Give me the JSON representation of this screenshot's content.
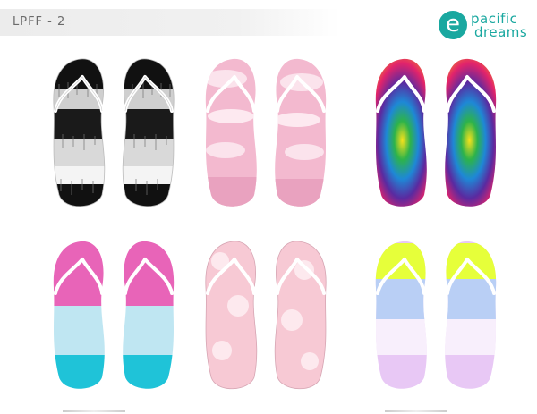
{
  "page": {
    "title": "LPFF - 2"
  },
  "brand": {
    "logo_text_line1": "pacific",
    "logo_text_line2": "dreams",
    "logo_mark": "e",
    "color": "#1aa8a0"
  },
  "designs": [
    {
      "id": "design-1",
      "name": "black-white-tie-dye",
      "colors": [
        "#111111",
        "#d8d8d8",
        "#ffffff"
      ]
    },
    {
      "id": "design-2",
      "name": "pink-tie-dye",
      "colors": [
        "#f3b9cf",
        "#fbe3ec",
        "#e796b6"
      ]
    },
    {
      "id": "design-3",
      "name": "rainbow-spiral-tie-dye",
      "colors": [
        "#5a2aa0",
        "#e2236b",
        "#f7e21b",
        "#2db34a",
        "#1e88d6"
      ]
    },
    {
      "id": "design-4",
      "name": "pink-blue-ombre",
      "colors": [
        "#e864b8",
        "#bfe6f2",
        "#1fc3d8"
      ]
    },
    {
      "id": "design-5",
      "name": "light-pink-marble",
      "colors": [
        "#f7c9d4",
        "#fde9ee",
        "#f3b3c2"
      ]
    },
    {
      "id": "design-6",
      "name": "pastel-neon-tie-dye",
      "colors": [
        "#e6ff3a",
        "#b9cff5",
        "#e8c8f5",
        "#ffffff"
      ]
    }
  ]
}
